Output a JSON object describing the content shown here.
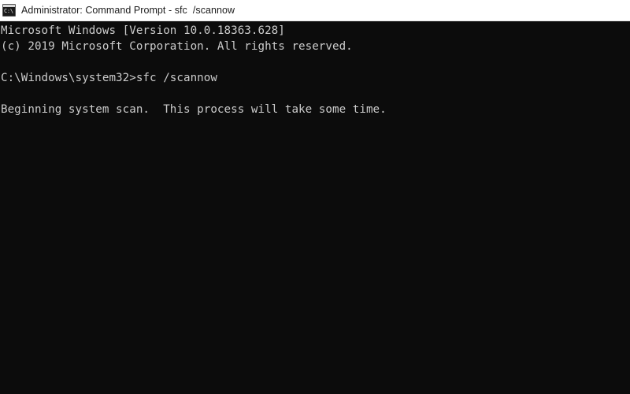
{
  "window": {
    "titlebar": {
      "icon_name": "cmd-console-icon",
      "icon_glyph": "C:\\",
      "title": "Administrator: Command Prompt - sfc  /scannow",
      "background_color": "#ffffff",
      "text_color": "#1c1c1c"
    },
    "console": {
      "background_color": "#0c0c0c",
      "text_color": "#cccccc",
      "lines": [
        "Microsoft Windows [Version 10.0.18363.628]",
        "(c) 2019 Microsoft Corporation. All rights reserved.",
        "",
        "C:\\Windows\\system32>sfc /scannow",
        "",
        "Beginning system scan.  This process will take some time."
      ]
    },
    "watermark": ""
  }
}
